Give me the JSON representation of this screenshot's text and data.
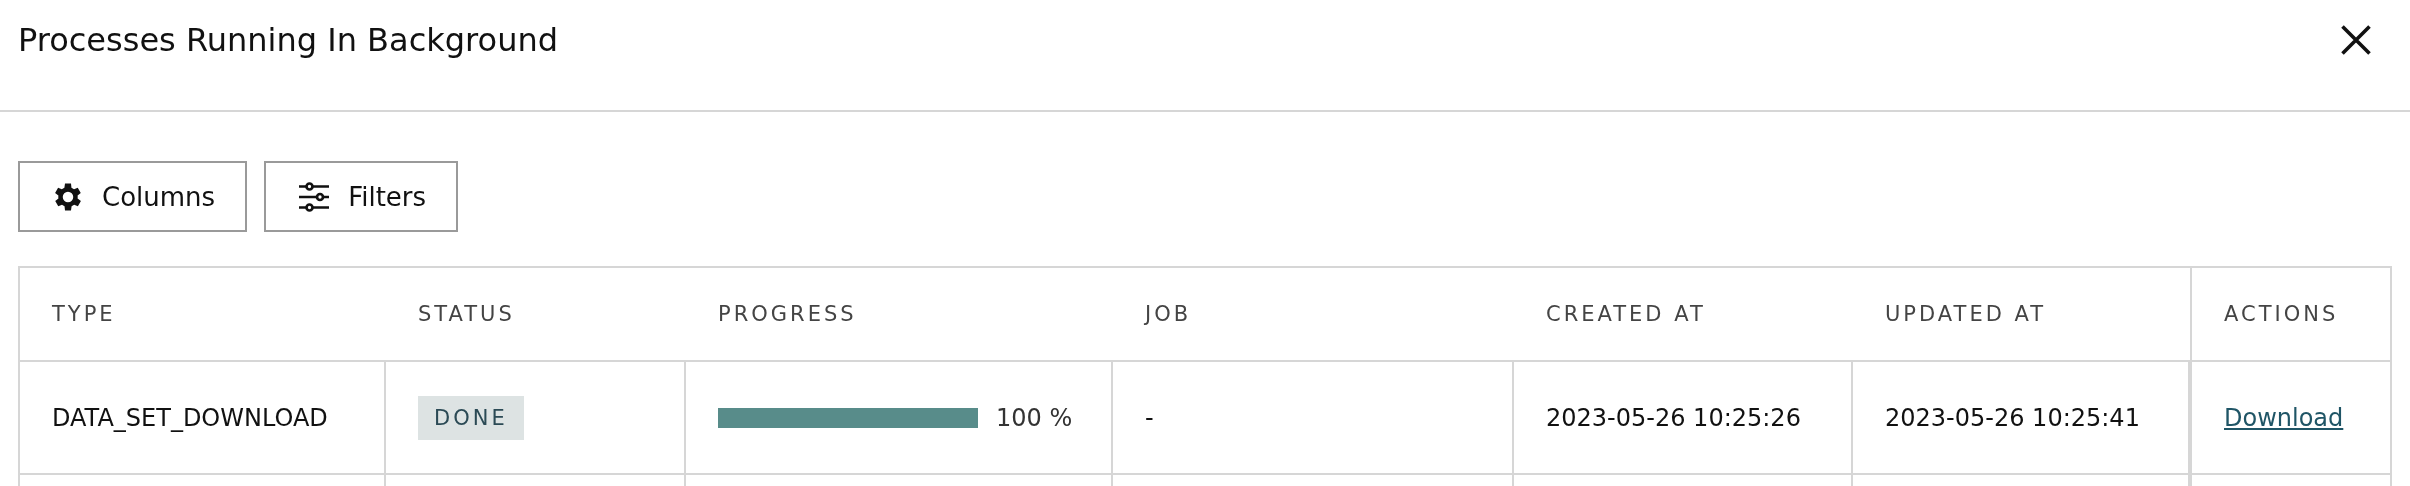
{
  "dialog": {
    "title": "Processes Running In Background"
  },
  "toolbar": [
    {
      "label": "Columns",
      "kind": "columns"
    },
    {
      "label": "Filters",
      "kind": "filters"
    }
  ],
  "table": {
    "columns": [
      "TYPE",
      "STATUS",
      "PROGRESS",
      "JOB",
      "CREATED AT",
      "UPDATED AT",
      "ACTIONS"
    ],
    "rows": [
      {
        "type": "DATA_SET_DOWNLOAD",
        "status": "DONE",
        "progress": {
          "level": 1,
          "reading": "100 %"
        },
        "job": "-",
        "created_at": "2023-05-26 10:25:26",
        "updated_at": "2023-05-26 10:25:41",
        "action": "Download"
      }
    ]
  }
}
